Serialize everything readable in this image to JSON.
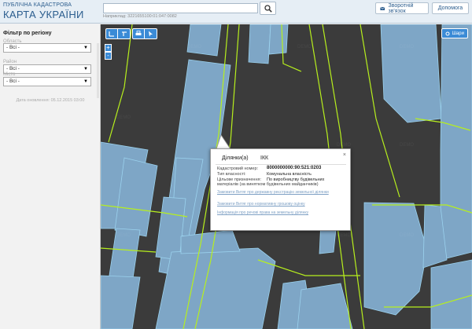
{
  "header": {
    "logo_small": "ПУБЛІЧНА КАДАСТРОВА",
    "logo_big": "КАРТА УКРАЇНИ",
    "search_value": "",
    "search_hint": "Наприклад: 3221655100:01:047:0082",
    "feedback_label": "Зворотній зв'язок",
    "help_label": "Допомога"
  },
  "sidebar": {
    "filter_title": "Фільтр по регіону",
    "filters": [
      {
        "label": "Область",
        "value": "- Всі -"
      },
      {
        "label": "Район",
        "value": "- Всі -"
      },
      {
        "label": "Місто",
        "value": "- Всі -"
      }
    ],
    "updated": "Дата оновлення: 05.12.2015 03:00"
  },
  "map": {
    "layers_label": "Шари",
    "zoom_in": "+",
    "zoom_out": "-",
    "watermark": "DEMO",
    "colors": {
      "background": "#3b3b3b",
      "parcel_fill": "#7ea6c6",
      "parcel_border": "#9bd2ee",
      "road_line": "#b7ef1d"
    }
  },
  "popup": {
    "close": "×",
    "tabs": [
      "Ділянки(а)",
      "ІКК"
    ],
    "rows": [
      {
        "label": "Кадастровий номер:",
        "value": "8000000000:90:521:0203"
      },
      {
        "label": "Тип власності:",
        "value": "Комунальна власність"
      },
      {
        "label": "Цільове призначення:",
        "value": "По виробництву будівельних"
      },
      {
        "label": "",
        "value": "матеріалів (за винятком будівельних майданчиків)"
      }
    ],
    "links": [
      "Замовити Витяг про державну реєстрацію земельної ділянки",
      "Замовити Витяг про нормативну грошову оцінку",
      "Інформація про речові права на земельну ділянку"
    ]
  }
}
